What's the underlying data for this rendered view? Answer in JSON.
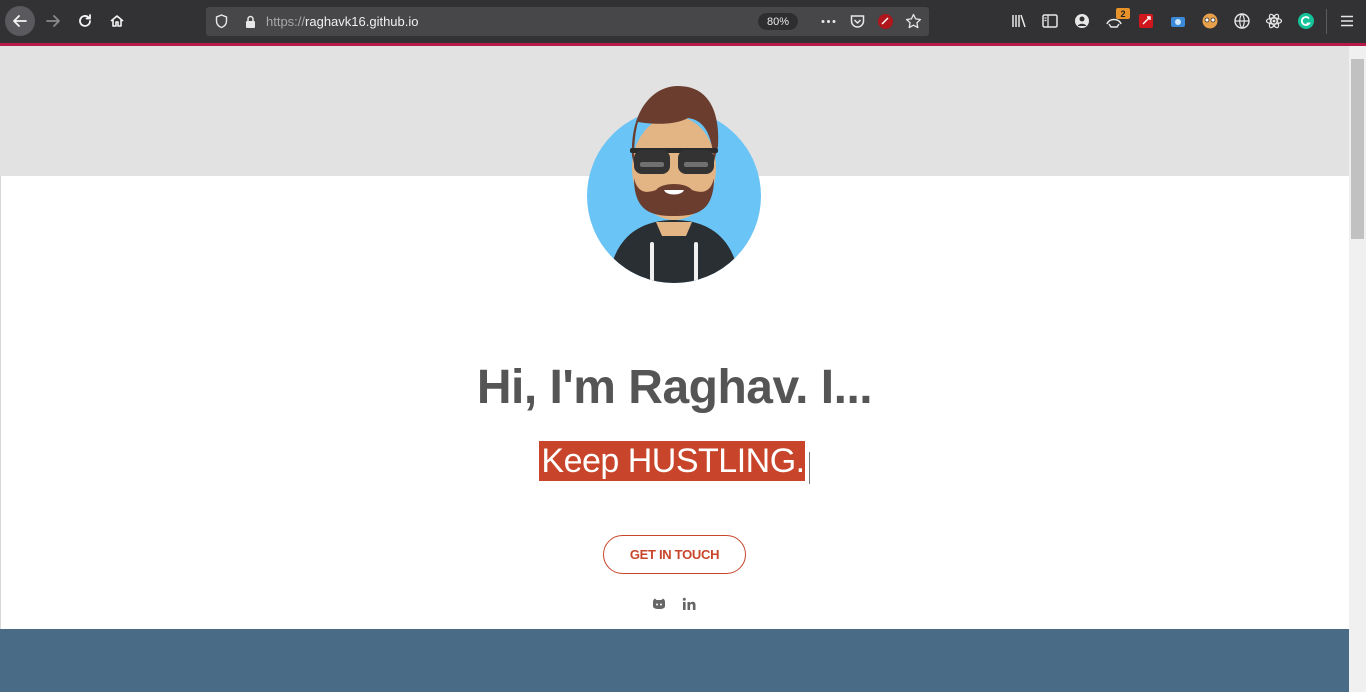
{
  "browser": {
    "url_scheme": "https://",
    "url_host": "raghavk16.github.io",
    "zoom": "80%",
    "extension_badge": "2"
  },
  "hero": {
    "heading": "Hi, I'm Raghav. I...",
    "tagline": "Keep HUSTLING.",
    "cta_label": "GET IN TOUCH"
  },
  "social": [
    "github-icon",
    "linkedin-icon"
  ],
  "colors": {
    "accent": "#c8452b",
    "heading": "#555555",
    "hero_band": "#e2e2e2",
    "footer_band": "#4a6b85",
    "tab_accent": "#b71a47"
  }
}
